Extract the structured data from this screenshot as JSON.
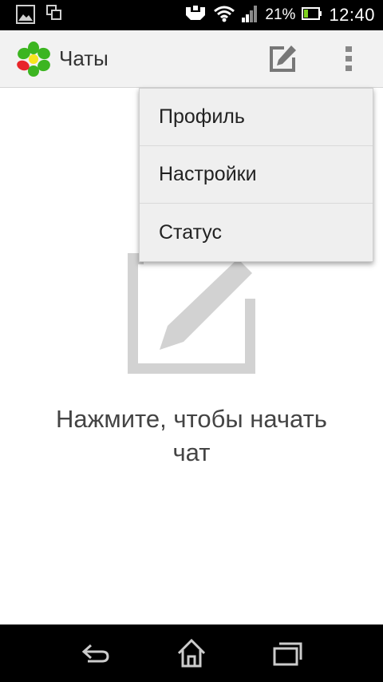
{
  "status_bar": {
    "battery_percent": "21%",
    "time": "12:40",
    "icons": [
      "gallery-icon",
      "screen-mirror-icon",
      "usb-icon",
      "wifi-icon",
      "signal-icon",
      "battery-icon"
    ]
  },
  "action_bar": {
    "title": "Чаты",
    "logo": "icq-flower-logo",
    "actions": [
      "compose-icon",
      "overflow-menu-icon"
    ]
  },
  "popup_menu": {
    "items": [
      {
        "label": "Профиль"
      },
      {
        "label": "Настройки"
      },
      {
        "label": "Статус"
      }
    ]
  },
  "empty_state": {
    "icon": "compose-icon",
    "line1": "Нажмите, чтобы начать",
    "line2": "чат"
  },
  "nav_bar": {
    "buttons": [
      "back-icon",
      "home-icon",
      "recent-apps-icon"
    ]
  },
  "colors": {
    "status_bar_bg": "#000000",
    "action_bar_bg": "#f2f2f2",
    "menu_bg": "#efefef",
    "logo_green": "#3cb521",
    "logo_red": "#e8262a",
    "empty_icon_gray": "#d2d2d2"
  }
}
